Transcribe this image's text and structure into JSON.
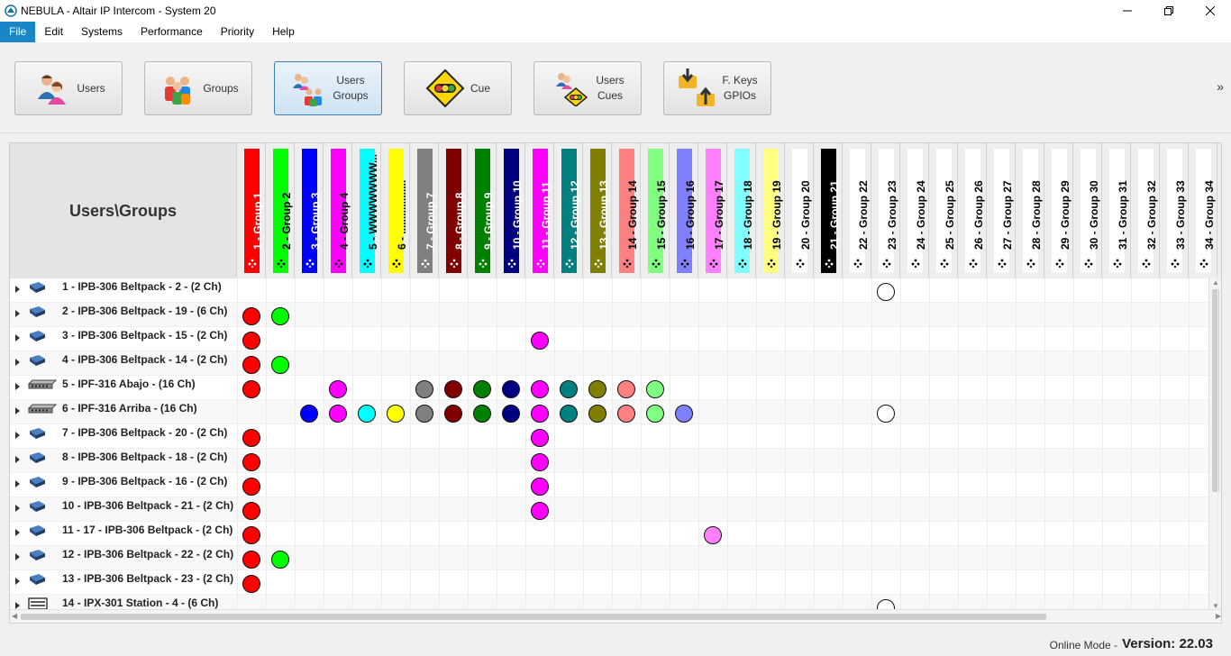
{
  "window": {
    "title": "NEBULA - Altair IP Intercom - System 20"
  },
  "menu": [
    {
      "label": "File",
      "active": true
    },
    {
      "label": "Edit"
    },
    {
      "label": "Systems"
    },
    {
      "label": "Performance"
    },
    {
      "label": "Priority"
    },
    {
      "label": "Help"
    }
  ],
  "toolbar": {
    "buttons": [
      {
        "lines": [
          "Users"
        ],
        "icon": "users-icon",
        "active": false
      },
      {
        "lines": [
          "Groups"
        ],
        "icon": "groups-icon",
        "active": false
      },
      {
        "lines": [
          "Users",
          "Groups"
        ],
        "icon": "users-groups-icon",
        "active": true
      },
      {
        "lines": [
          "Cue"
        ],
        "icon": "cue-icon",
        "active": false
      },
      {
        "lines": [
          "Users",
          "Cues"
        ],
        "icon": "users-cues-icon",
        "active": false
      },
      {
        "lines": [
          "F. Keys",
          "GPIOs"
        ],
        "icon": "fkeys-gpios-icon",
        "active": false
      }
    ],
    "more_label": "»"
  },
  "grid": {
    "corner_title": "Users\\Groups",
    "columns": [
      {
        "label": "1 - Group 1",
        "color": "#ff0000",
        "text": "#ffffff"
      },
      {
        "label": "2 - Group 2",
        "color": "#00ff00",
        "text": "#000000"
      },
      {
        "label": "3 - Group 3",
        "color": "#0000ff",
        "text": "#ffffff"
      },
      {
        "label": "4 - Group 4",
        "color": "#ff00ff",
        "text": "#000000"
      },
      {
        "label": "5 - WWWWWWW...",
        "color": "#00ffff",
        "text": "#000000"
      },
      {
        "label": "6 - ..................",
        "color": "#ffff00",
        "text": "#000000"
      },
      {
        "label": "7 - Group 7",
        "color": "#808080",
        "text": "#ffffff"
      },
      {
        "label": "8 - Group 8",
        "color": "#800000",
        "text": "#ffffff"
      },
      {
        "label": "9 - Group 9",
        "color": "#008000",
        "text": "#ffffff"
      },
      {
        "label": "10 - Group 10",
        "color": "#000080",
        "text": "#ffffff"
      },
      {
        "label": "11 - Group 11",
        "color": "#ff00ff",
        "text": "#ffffff"
      },
      {
        "label": "12 - Group 12",
        "color": "#008080",
        "text": "#ffffff"
      },
      {
        "label": "13 - Group 13",
        "color": "#808000",
        "text": "#ffffff"
      },
      {
        "label": "14 - Group 14",
        "color": "#ff8080",
        "text": "#000000"
      },
      {
        "label": "15 - Group 15",
        "color": "#80ff80",
        "text": "#000000"
      },
      {
        "label": "16 - Group 16",
        "color": "#8080ff",
        "text": "#000000"
      },
      {
        "label": "17 - Group 17",
        "color": "#ff80ff",
        "text": "#000000"
      },
      {
        "label": "18 - Group 18",
        "color": "#80ffff",
        "text": "#000000"
      },
      {
        "label": "19 - Group 19",
        "color": "#ffff80",
        "text": "#000000"
      },
      {
        "label": "20 - Group 20",
        "color": "#ffffff",
        "text": "#000000"
      },
      {
        "label": "21 - Group 21",
        "color": "#000000",
        "text": "#ffffff"
      },
      {
        "label": "22 - Group 22",
        "color": "#ffffff",
        "text": "#000000"
      },
      {
        "label": "23 - Group 23",
        "color": "#ffffff",
        "text": "#000000"
      },
      {
        "label": "24 - Group 24",
        "color": "#ffffff",
        "text": "#000000"
      },
      {
        "label": "25 - Group 25",
        "color": "#ffffff",
        "text": "#000000"
      },
      {
        "label": "26 - Group 26",
        "color": "#ffffff",
        "text": "#000000"
      },
      {
        "label": "27 - Group 27",
        "color": "#ffffff",
        "text": "#000000"
      },
      {
        "label": "28 - Group 28",
        "color": "#ffffff",
        "text": "#000000"
      },
      {
        "label": "29 - Group 29",
        "color": "#ffffff",
        "text": "#000000"
      },
      {
        "label": "30 - Group 30",
        "color": "#ffffff",
        "text": "#000000"
      },
      {
        "label": "31 - Group 31",
        "color": "#ffffff",
        "text": "#000000"
      },
      {
        "label": "32 - Group 32",
        "color": "#ffffff",
        "text": "#000000"
      },
      {
        "label": "33 - Group 33",
        "color": "#ffffff",
        "text": "#000000"
      },
      {
        "label": "34 - Group 34",
        "color": "#ffffff",
        "text": "#000000"
      }
    ],
    "rows": [
      {
        "label": "1 - IPB-306 Beltpack - 2 - (2 Ch)",
        "icon": "beltpack-icon",
        "cells": [
          23
        ]
      },
      {
        "label": "2 - IPB-306 Beltpack - 19 - (6 Ch)",
        "icon": "beltpack-icon",
        "cells": [
          1,
          2
        ]
      },
      {
        "label": "3 - IPB-306 Beltpack - 15 - (2 Ch)",
        "icon": "beltpack-icon",
        "cells": [
          1,
          11
        ]
      },
      {
        "label": "4 - IPB-306 Beltpack - 14 - (2 Ch)",
        "icon": "beltpack-icon",
        "cells": [
          1,
          2
        ]
      },
      {
        "label": "5 - IPF-316 Abajo - (16 Ch)",
        "icon": "panel-icon",
        "cells": [
          1,
          4,
          7,
          8,
          9,
          10,
          11,
          12,
          13,
          14,
          15
        ]
      },
      {
        "label": "6 - IPF-316 Arriba - (16 Ch)",
        "icon": "panel-icon",
        "cells": [
          3,
          4,
          5,
          6,
          7,
          8,
          9,
          10,
          11,
          12,
          13,
          14,
          15,
          16,
          23
        ]
      },
      {
        "label": "7 - IPB-306 Beltpack - 20 - (2 Ch)",
        "icon": "beltpack-icon",
        "cells": [
          1,
          11
        ]
      },
      {
        "label": "8 - IPB-306 Beltpack - 18 - (2 Ch)",
        "icon": "beltpack-icon",
        "cells": [
          1,
          11
        ]
      },
      {
        "label": "9 - IPB-306 Beltpack - 16 - (2 Ch)",
        "icon": "beltpack-icon",
        "cells": [
          1,
          11
        ]
      },
      {
        "label": "10 - IPB-306 Beltpack - 21 - (2 Ch)",
        "icon": "beltpack-icon",
        "cells": [
          1,
          11
        ]
      },
      {
        "label": "11 - 17 - IPB-306 Beltpack - (2 Ch)",
        "icon": "beltpack-icon",
        "cells": [
          1,
          17
        ]
      },
      {
        "label": "12 - IPB-306 Beltpack - 22 - (2 Ch)",
        "icon": "beltpack-icon",
        "cells": [
          1,
          2
        ]
      },
      {
        "label": "13 - IPB-306 Beltpack - 23 - (2 Ch)",
        "icon": "beltpack-icon",
        "cells": [
          1
        ]
      },
      {
        "label": "14 - IPX-301 Station - 4 - (6 Ch)",
        "icon": "station-icon",
        "cells": [
          23
        ]
      }
    ]
  },
  "status": {
    "mode": "Online Mode -",
    "version": "Version: 22.03"
  }
}
